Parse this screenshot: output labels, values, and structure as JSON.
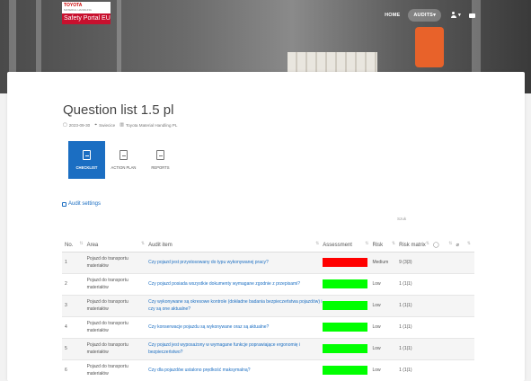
{
  "brand": {
    "logo_text": "TOYOTA",
    "logo_subtext": "MATERIAL HANDLING",
    "portal_name": "Safety Portal EU"
  },
  "topnav": {
    "home": "HOME",
    "audits": "AUDITS",
    "audits_caret": "▾",
    "user_caret": "▾"
  },
  "page": {
    "title": "Question list 1.5 pl",
    "date": "2023-09-30",
    "location": "Swiecice",
    "company": "Toyota Material Handling PL"
  },
  "tabs": [
    {
      "label": "CHECKLIST",
      "active": true
    },
    {
      "label": "ACTION PLAN",
      "active": false
    },
    {
      "label": "REPORTS",
      "active": false
    }
  ],
  "audit_settings_label": "Audit settings",
  "search_label": "Szuk",
  "table": {
    "headers": {
      "no": "No.",
      "area": "Area",
      "item": "Audit item",
      "assessment": "Assessment",
      "risk": "Risk",
      "matrix": "Risk matrix"
    },
    "rows": [
      {
        "no": "1",
        "area": "Pojazd do transportu materiałów",
        "item": "Czy pojazd jest przystosowany do typu wykonywanej pracy?",
        "assessment": "red",
        "risk": "Medium",
        "matrix": "9 (3|3)"
      },
      {
        "no": "2",
        "area": "Pojazd do transportu materiałów",
        "item": "Czy pojazd posiada wszystkie dokumenty wymagane zgodnie z przepisami?",
        "assessment": "green",
        "risk": "Low",
        "matrix": "1 (1|1)"
      },
      {
        "no": "3",
        "area": "Pojazd do transportu materiałów",
        "item": "Czy wykonywane są okresowe kontrole (dokładne badania bezpieczeństwa pojazdów) i czy są one aktualne?",
        "assessment": "green",
        "risk": "Low",
        "matrix": "1 (1|1)"
      },
      {
        "no": "4",
        "area": "Pojazd do transportu materiałów",
        "item": "Czy konserwacje pojazdu są wykonywane oraz są aktualne?",
        "assessment": "green",
        "risk": "Low",
        "matrix": "1 (1|1)"
      },
      {
        "no": "5",
        "area": "Pojazd do transportu materiałów",
        "item": "Czy pojazd jest wyposażony w wymagane funkcje poprawiające ergonomię i bezpieczeństwo?",
        "assessment": "green",
        "risk": "Low",
        "matrix": "1 (1|1)"
      },
      {
        "no": "6",
        "area": "Pojazd do transportu materiałów",
        "item": "Czy dla pojazdów ustalono prędkość maksymalną?",
        "assessment": "green",
        "risk": "Low",
        "matrix": "1 (1|1)"
      }
    ]
  },
  "colors": {
    "accent": "#1b6ec2",
    "brand_red": "#c8102e",
    "assessment_red": "#ff0000",
    "assessment_green": "#00ff00"
  }
}
